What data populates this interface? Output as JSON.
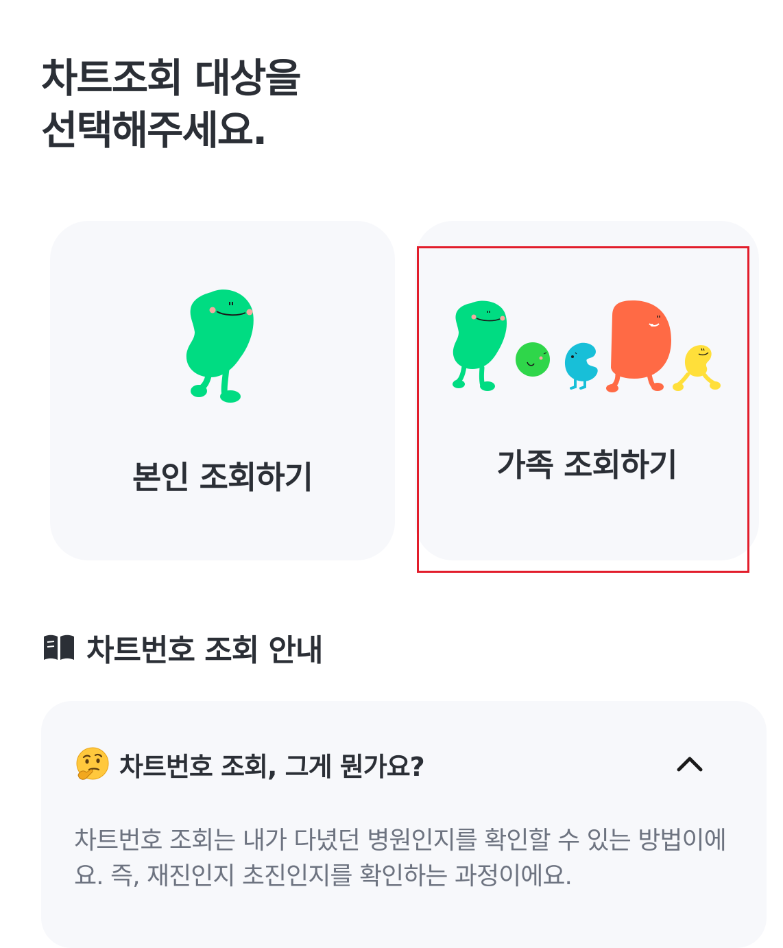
{
  "header": {
    "title_line1": "차트조회 대상을",
    "title_line2": "선택해주세요."
  },
  "options": {
    "self_label": "본인 조회하기",
    "family_label": "가족 조회하기"
  },
  "guide": {
    "section_title": "차트번호 조회 안내",
    "question": "차트번호 조회, 그게 뭔가요?",
    "answer": "차트번호 조회는 내가 다녔던 병원인지를 확인할 수 있는 방법이에요. 즉, 재진인지 초진인지를 확인하는 과정이에요."
  },
  "icons": {
    "book": "book-icon",
    "thinking": "thinking-face-icon",
    "chevron": "chevron-up-icon"
  },
  "colors": {
    "mascot_green": "#00dc82",
    "mascot_lime": "#2fd64a",
    "mascot_blue": "#18bfd8",
    "mascot_orange": "#ff6a45",
    "mascot_yellow": "#ffdf3a",
    "card_bg": "#f7f8fb",
    "highlight": "#e21d2b"
  }
}
